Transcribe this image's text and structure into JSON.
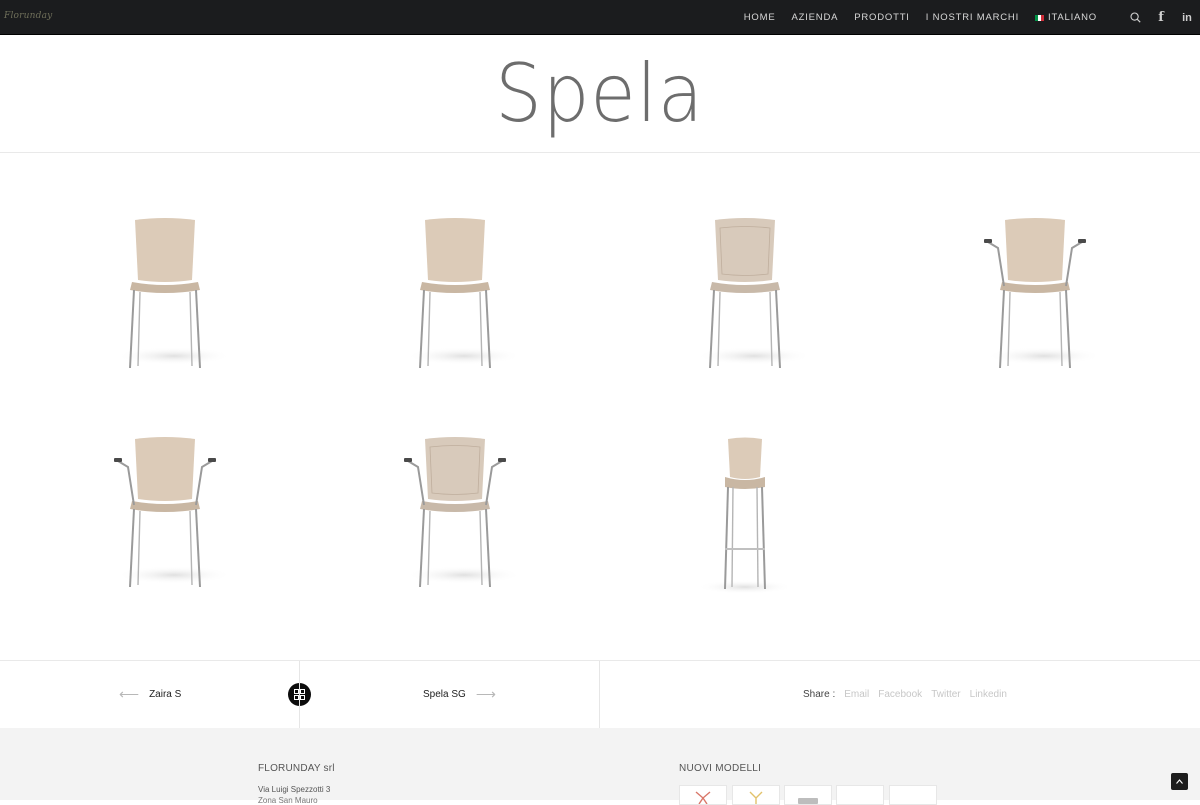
{
  "brand": {
    "logo_text": "Florunday"
  },
  "nav": {
    "items": [
      {
        "label": "HOME"
      },
      {
        "label": "AZIENDA"
      },
      {
        "label": "PRODOTTI"
      },
      {
        "label": "I NOSTRI MARCHI"
      },
      {
        "label": "ITALIANO",
        "flag": [
          "#009246",
          "#ffffff",
          "#ce2b37"
        ]
      }
    ],
    "icons": [
      "search-icon",
      "facebook-icon",
      "linkedin-icon"
    ],
    "facebook_glyph": "f",
    "linkedin_glyph": "in"
  },
  "page": {
    "title": "Spela"
  },
  "products": [
    {
      "name": "chair-4-legs-wood",
      "seat": "wood",
      "arms": false,
      "stool": false
    },
    {
      "name": "chair-4-legs-wood-padded-seat",
      "seat": "wood-padded",
      "arms": false,
      "stool": false
    },
    {
      "name": "chair-4-legs-upholstered",
      "seat": "upholstered",
      "arms": false,
      "stool": false
    },
    {
      "name": "chair-armrests-wood",
      "seat": "wood",
      "arms": true,
      "stool": false
    },
    {
      "name": "chair-armrests-wood-padded",
      "seat": "wood-padded",
      "arms": true,
      "stool": false
    },
    {
      "name": "chair-armrests-upholstered",
      "seat": "upholstered",
      "arms": true,
      "stool": false
    },
    {
      "name": "stool-wood",
      "seat": "wood",
      "arms": false,
      "stool": true
    }
  ],
  "post_nav": {
    "prev_label": "Zaira S",
    "next_label": "Spela SG",
    "prev_arrow": "⟵",
    "next_arrow": "⟶",
    "share_label": "Share :",
    "share_links": [
      "Email",
      "Facebook",
      "Twitter",
      "Linkedin"
    ]
  },
  "footer": {
    "company": "FLORUNDAY srl",
    "address_line1": "Via Luigi Spezzotti 3",
    "address_line2": "Zona San Mauro",
    "new_models_title": "NUOVI MODELLI"
  },
  "colors": {
    "navbar_bg": "#1b1c1e",
    "wood": "#dccbb8",
    "wood_dark": "#c9b7a3",
    "fabric": "#d8cabb",
    "chrome": "#9a9a9a",
    "footer_bg": "#f3f3f3"
  }
}
